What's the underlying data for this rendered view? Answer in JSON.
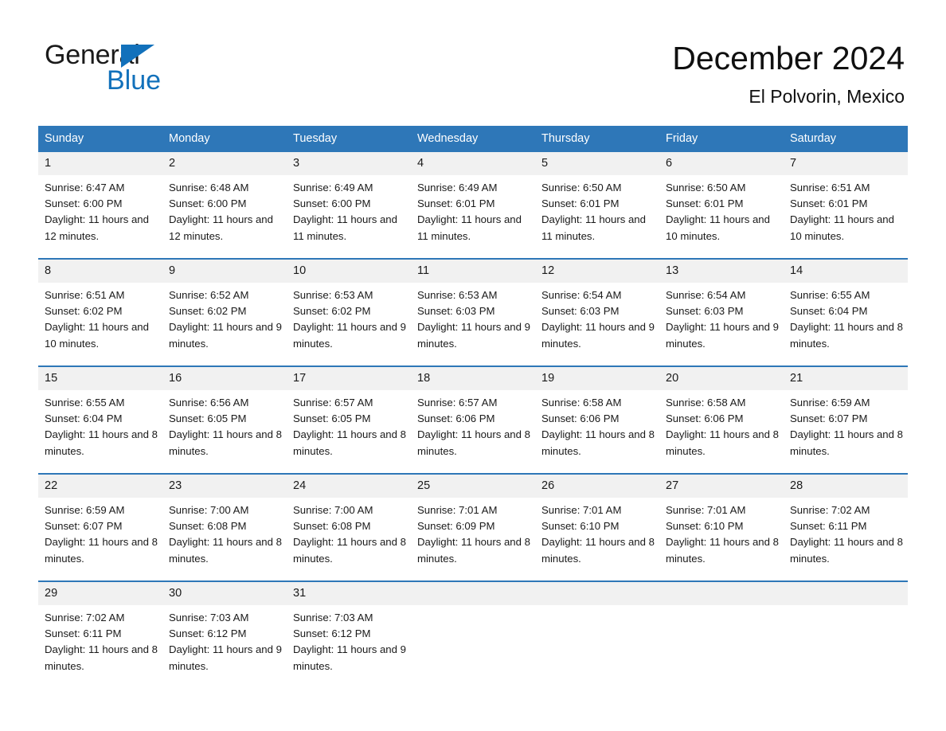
{
  "brand": {
    "name_part1": "General",
    "name_part2": "Blue",
    "triangle_icon": "triangle-logo-icon",
    "accent_color": "#1271bb"
  },
  "header": {
    "title": "December 2024",
    "subtitle": "El Polvorin, Mexico"
  },
  "theme": {
    "header_blue": "#2e77b8",
    "daynum_band": "#f1f1f1",
    "row_divider": "#2e77b8"
  },
  "calendar": {
    "weekdays": [
      "Sunday",
      "Monday",
      "Tuesday",
      "Wednesday",
      "Thursday",
      "Friday",
      "Saturday"
    ],
    "weeks": [
      [
        {
          "day": "1",
          "sunrise": "Sunrise: 6:47 AM",
          "sunset": "Sunset: 6:00 PM",
          "daylight": "Daylight: 11 hours and 12 minutes."
        },
        {
          "day": "2",
          "sunrise": "Sunrise: 6:48 AM",
          "sunset": "Sunset: 6:00 PM",
          "daylight": "Daylight: 11 hours and 12 minutes."
        },
        {
          "day": "3",
          "sunrise": "Sunrise: 6:49 AM",
          "sunset": "Sunset: 6:00 PM",
          "daylight": "Daylight: 11 hours and 11 minutes."
        },
        {
          "day": "4",
          "sunrise": "Sunrise: 6:49 AM",
          "sunset": "Sunset: 6:01 PM",
          "daylight": "Daylight: 11 hours and 11 minutes."
        },
        {
          "day": "5",
          "sunrise": "Sunrise: 6:50 AM",
          "sunset": "Sunset: 6:01 PM",
          "daylight": "Daylight: 11 hours and 11 minutes."
        },
        {
          "day": "6",
          "sunrise": "Sunrise: 6:50 AM",
          "sunset": "Sunset: 6:01 PM",
          "daylight": "Daylight: 11 hours and 10 minutes."
        },
        {
          "day": "7",
          "sunrise": "Sunrise: 6:51 AM",
          "sunset": "Sunset: 6:01 PM",
          "daylight": "Daylight: 11 hours and 10 minutes."
        }
      ],
      [
        {
          "day": "8",
          "sunrise": "Sunrise: 6:51 AM",
          "sunset": "Sunset: 6:02 PM",
          "daylight": "Daylight: 11 hours and 10 minutes."
        },
        {
          "day": "9",
          "sunrise": "Sunrise: 6:52 AM",
          "sunset": "Sunset: 6:02 PM",
          "daylight": "Daylight: 11 hours and 9 minutes."
        },
        {
          "day": "10",
          "sunrise": "Sunrise: 6:53 AM",
          "sunset": "Sunset: 6:02 PM",
          "daylight": "Daylight: 11 hours and 9 minutes."
        },
        {
          "day": "11",
          "sunrise": "Sunrise: 6:53 AM",
          "sunset": "Sunset: 6:03 PM",
          "daylight": "Daylight: 11 hours and 9 minutes."
        },
        {
          "day": "12",
          "sunrise": "Sunrise: 6:54 AM",
          "sunset": "Sunset: 6:03 PM",
          "daylight": "Daylight: 11 hours and 9 minutes."
        },
        {
          "day": "13",
          "sunrise": "Sunrise: 6:54 AM",
          "sunset": "Sunset: 6:03 PM",
          "daylight": "Daylight: 11 hours and 9 minutes."
        },
        {
          "day": "14",
          "sunrise": "Sunrise: 6:55 AM",
          "sunset": "Sunset: 6:04 PM",
          "daylight": "Daylight: 11 hours and 8 minutes."
        }
      ],
      [
        {
          "day": "15",
          "sunrise": "Sunrise: 6:55 AM",
          "sunset": "Sunset: 6:04 PM",
          "daylight": "Daylight: 11 hours and 8 minutes."
        },
        {
          "day": "16",
          "sunrise": "Sunrise: 6:56 AM",
          "sunset": "Sunset: 6:05 PM",
          "daylight": "Daylight: 11 hours and 8 minutes."
        },
        {
          "day": "17",
          "sunrise": "Sunrise: 6:57 AM",
          "sunset": "Sunset: 6:05 PM",
          "daylight": "Daylight: 11 hours and 8 minutes."
        },
        {
          "day": "18",
          "sunrise": "Sunrise: 6:57 AM",
          "sunset": "Sunset: 6:06 PM",
          "daylight": "Daylight: 11 hours and 8 minutes."
        },
        {
          "day": "19",
          "sunrise": "Sunrise: 6:58 AM",
          "sunset": "Sunset: 6:06 PM",
          "daylight": "Daylight: 11 hours and 8 minutes."
        },
        {
          "day": "20",
          "sunrise": "Sunrise: 6:58 AM",
          "sunset": "Sunset: 6:06 PM",
          "daylight": "Daylight: 11 hours and 8 minutes."
        },
        {
          "day": "21",
          "sunrise": "Sunrise: 6:59 AM",
          "sunset": "Sunset: 6:07 PM",
          "daylight": "Daylight: 11 hours and 8 minutes."
        }
      ],
      [
        {
          "day": "22",
          "sunrise": "Sunrise: 6:59 AM",
          "sunset": "Sunset: 6:07 PM",
          "daylight": "Daylight: 11 hours and 8 minutes."
        },
        {
          "day": "23",
          "sunrise": "Sunrise: 7:00 AM",
          "sunset": "Sunset: 6:08 PM",
          "daylight": "Daylight: 11 hours and 8 minutes."
        },
        {
          "day": "24",
          "sunrise": "Sunrise: 7:00 AM",
          "sunset": "Sunset: 6:08 PM",
          "daylight": "Daylight: 11 hours and 8 minutes."
        },
        {
          "day": "25",
          "sunrise": "Sunrise: 7:01 AM",
          "sunset": "Sunset: 6:09 PM",
          "daylight": "Daylight: 11 hours and 8 minutes."
        },
        {
          "day": "26",
          "sunrise": "Sunrise: 7:01 AM",
          "sunset": "Sunset: 6:10 PM",
          "daylight": "Daylight: 11 hours and 8 minutes."
        },
        {
          "day": "27",
          "sunrise": "Sunrise: 7:01 AM",
          "sunset": "Sunset: 6:10 PM",
          "daylight": "Daylight: 11 hours and 8 minutes."
        },
        {
          "day": "28",
          "sunrise": "Sunrise: 7:02 AM",
          "sunset": "Sunset: 6:11 PM",
          "daylight": "Daylight: 11 hours and 8 minutes."
        }
      ],
      [
        {
          "day": "29",
          "sunrise": "Sunrise: 7:02 AM",
          "sunset": "Sunset: 6:11 PM",
          "daylight": "Daylight: 11 hours and 8 minutes."
        },
        {
          "day": "30",
          "sunrise": "Sunrise: 7:03 AM",
          "sunset": "Sunset: 6:12 PM",
          "daylight": "Daylight: 11 hours and 9 minutes."
        },
        {
          "day": "31",
          "sunrise": "Sunrise: 7:03 AM",
          "sunset": "Sunset: 6:12 PM",
          "daylight": "Daylight: 11 hours and 9 minutes."
        },
        {
          "day": "",
          "sunrise": "",
          "sunset": "",
          "daylight": ""
        },
        {
          "day": "",
          "sunrise": "",
          "sunset": "",
          "daylight": ""
        },
        {
          "day": "",
          "sunrise": "",
          "sunset": "",
          "daylight": ""
        },
        {
          "day": "",
          "sunrise": "",
          "sunset": "",
          "daylight": ""
        }
      ]
    ]
  }
}
